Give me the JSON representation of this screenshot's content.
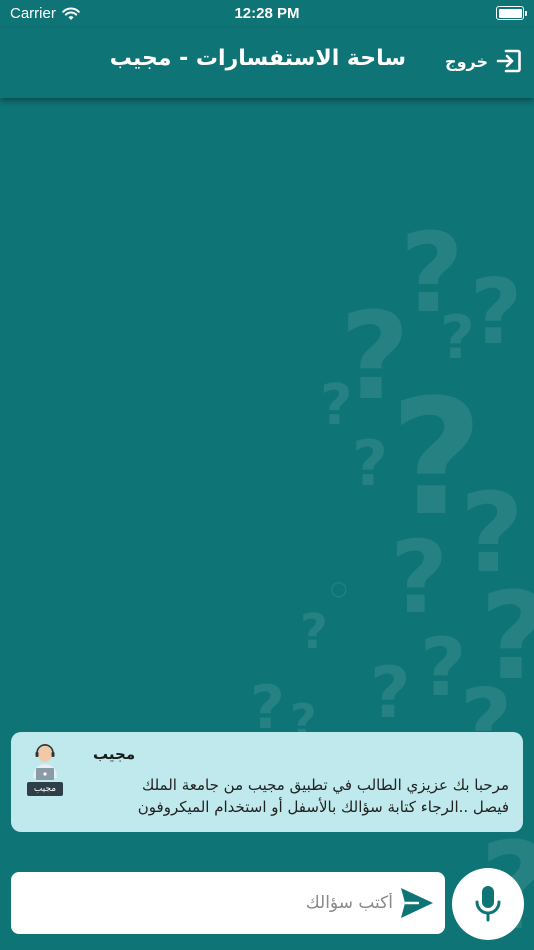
{
  "status_bar": {
    "carrier": "Carrier",
    "time": "12:28 PM"
  },
  "header": {
    "title": "ساحة الاستفسارات - مجيب",
    "logout_label": "خروج"
  },
  "chat": {
    "messages": [
      {
        "sender": "مجيب",
        "avatar_label": "مجيب",
        "text": "مرحبا بك عزيزي الطالب في تطبيق مجيب من جامعة الملك فيصل ..الرجاء كتابة سؤالك بالأسفل أو استخدام الميكروفون"
      }
    ]
  },
  "composer": {
    "placeholder": "أكتب سؤالك",
    "value": "",
    "send_icon": "send-icon",
    "mic_icon": "microphone-icon"
  },
  "theme": {
    "background": "#0f7476",
    "bubble": "#bfe9ec",
    "accent": "#0f7476"
  }
}
